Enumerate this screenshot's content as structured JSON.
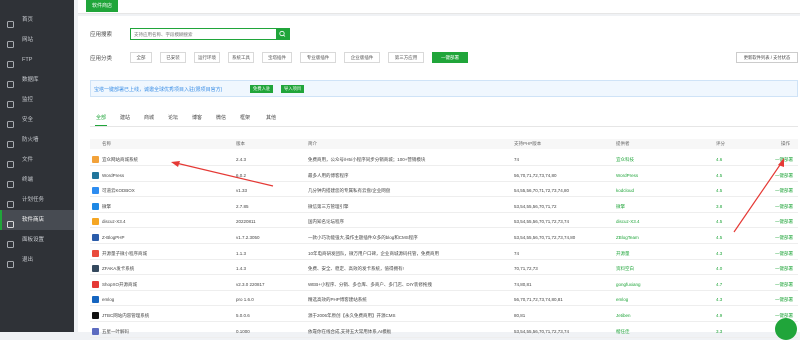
{
  "sidebar": {
    "brand": "",
    "items": [
      {
        "label": "首页",
        "icon": "home-icon"
      },
      {
        "label": "网站",
        "icon": "globe-icon"
      },
      {
        "label": "FTP",
        "icon": "ftp-icon"
      },
      {
        "label": "数据库",
        "icon": "database-icon"
      },
      {
        "label": "监控",
        "icon": "monitor-icon"
      },
      {
        "label": "安全",
        "icon": "shield-icon"
      },
      {
        "label": "防火墙",
        "icon": "firewall-icon"
      },
      {
        "label": "文件",
        "icon": "folder-icon"
      },
      {
        "label": "终端",
        "icon": "terminal-icon"
      },
      {
        "label": "计划任务",
        "icon": "clock-icon"
      },
      {
        "label": "软件商店",
        "icon": "store-icon",
        "active": true
      },
      {
        "label": "面板设置",
        "icon": "gear-icon"
      },
      {
        "label": "退出",
        "icon": "logout-icon"
      }
    ]
  },
  "page_tab": "软件商店",
  "search": {
    "label": "应用搜索",
    "placeholder": "支持应用名称、字段模糊搜索"
  },
  "category": {
    "label": "应用分类",
    "items": [
      "全部",
      "已安装",
      "运行环境",
      "系统工具",
      "宝塔插件",
      "专业版插件",
      "企业版插件",
      "第三方应用",
      "一键部署"
    ],
    "active_index": 8
  },
  "update_button": "更新软件列表 / 支付状态",
  "notice": {
    "text": "宝塔一键部署已上线，诚邀全球优秀项目入驻(限项目官方)",
    "btn1": "免费入驻",
    "btn2": "导入项目"
  },
  "subtabs": {
    "items": [
      "全部",
      "建站",
      "商城",
      "论坛",
      "博客",
      "微信",
      "框架",
      "其他"
    ],
    "active_index": 0
  },
  "table": {
    "headers": [
      "名称",
      "版本",
      "简介",
      "支持PHP版本",
      "提供者",
      "评分",
      "操作"
    ],
    "rows": [
      {
        "name": "宜众网站商城系统",
        "version": "2.4.3",
        "desc": "免费商用，公众号/H5/小程序同步分销商城；100+营销模块",
        "php": "74",
        "provider": "宜众科技",
        "score": "4.6",
        "action": "一键部署",
        "icon_color": "#f2a23a"
      },
      {
        "name": "WordPress",
        "version": "6.0.2",
        "desc": "最多人用的博客程序",
        "php": "56,70,71,72,73,74,80",
        "provider": "WordPress",
        "score": "4.5",
        "action": "一键部署",
        "icon_color": "#21759b"
      },
      {
        "name": "可道云KODBOX",
        "version": "v1.33",
        "desc": "几分钟内搭建您的专属私有云盘/企业网盘",
        "php": "54,55,56,70,71,72,73,74,80",
        "provider": "kodcloud",
        "score": "4.5",
        "action": "一键部署",
        "icon_color": "#2d8cf0"
      },
      {
        "name": "微擎",
        "version": "2.7.85",
        "desc": "微信第三方管理引擎",
        "php": "53,54,55,56,70,71,72",
        "provider": "微擎",
        "score": "3.8",
        "action": "一键部署",
        "icon_color": "#1e88e5"
      },
      {
        "name": "discuz-X3.4",
        "version": "20220811",
        "desc": "国内知名论坛程序",
        "php": "53,54,55,56,70,71,72,73,74",
        "provider": "discuz-X3.4",
        "score": "4.5",
        "action": "一键部署",
        "icon_color": "#f5a623"
      },
      {
        "name": "Z-BlogPHP",
        "version": "v1.7.2.3050",
        "desc": "一款小巧功能强大,操作主题插件众多的blog和CMS程序",
        "php": "53,54,55,56,70,71,72,73,74,80",
        "provider": "ZBlogTeam",
        "score": "4.5",
        "action": "一键部署",
        "icon_color": "#2a5caa"
      },
      {
        "name": "开源量子微小程序商城",
        "version": "1.1.3",
        "desc": "10年电商研发团队，微万用户口碑，企业商城源码托管，免费商用",
        "php": "74",
        "provider": "开源量",
        "score": "4.3",
        "action": "一键部署",
        "icon_color": "#e94b3c"
      },
      {
        "name": "ZFAKA发卡系统",
        "version": "1.4.3",
        "desc": "免费、安全、稳定、高效的发卡系统，值得拥有!",
        "php": "70,71,72,73",
        "provider": "资料空白",
        "score": "4.0",
        "action": "一键部署",
        "icon_color": "#34495e"
      },
      {
        "name": "ShopXO开源商城",
        "version": "v2.3.0 220817",
        "desc": "WEB+小程序、分销、多仓库、多商户、多门店、DIY装修拖拽",
        "php": "74,80,81",
        "provider": "gongfuxiang",
        "score": "4.7",
        "action": "一键部署",
        "icon_color": "#e53935"
      },
      {
        "name": "emlog",
        "version": "pro 1.6.0",
        "desc": "精选高效的PHP博客建站系统",
        "php": "56,70,71,72,73,74,80,81",
        "provider": "emlog",
        "score": "4.3",
        "action": "一键部署",
        "icon_color": "#1565c0"
      },
      {
        "name": "JTBC网站内容管理系统",
        "version": "5.0.0.6",
        "desc": "源于2006年原创【永久免费商用】开源CMS",
        "php": "80,81",
        "provider": "Jetiben",
        "score": "4.9",
        "action": "一键部署",
        "icon_color": "#111111"
      },
      {
        "name": "五星一叶解码",
        "version": "0.1000",
        "desc": "依靠你在线合成,支持五大常用体系,AI模板",
        "php": "53,54,55,56,70,71,72,73,74",
        "provider": "楷任佳",
        "score": "3.3",
        "action": "一键部署",
        "icon_color": "#5c6bc0"
      }
    ]
  },
  "colors": {
    "accent": "#20a53a",
    "sidebar_bg": "#2f3237",
    "arrow": "#e53935"
  }
}
